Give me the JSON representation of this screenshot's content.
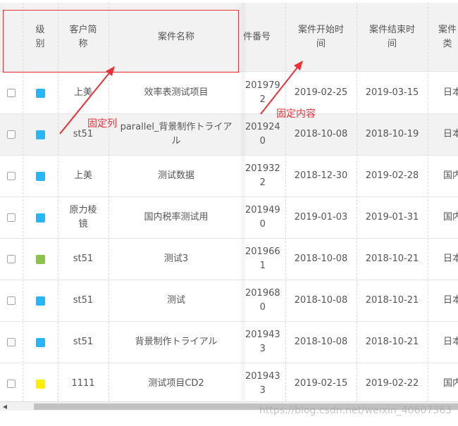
{
  "headers": {
    "level": "级\n别",
    "client": "客户简\n称",
    "case_name": "案件名称",
    "case_no": "件番号",
    "start": "案件开始时\n间",
    "end": "案件结束时\n间",
    "type": "案件\n类"
  },
  "rows": [
    {
      "color": "#29b6f6",
      "client": "上美",
      "name": "效率表测试项目",
      "no": "201979\n2",
      "start": "2019-02-25",
      "end": "2019-03-15",
      "type": "日本"
    },
    {
      "color": "#29b6f6",
      "client": "st51",
      "name": "parallel_背景制作トライア\nル",
      "no": "201924\n0",
      "start": "2018-10-08",
      "end": "2018-10-19",
      "type": "日本"
    },
    {
      "color": "#29b6f6",
      "client": "上美",
      "name": "测试数据",
      "no": "201932\n2",
      "start": "2018-12-30",
      "end": "2019-02-28",
      "type": "国内"
    },
    {
      "color": "#29b6f6",
      "client": "原力棱\n镜",
      "name": "国内税率测试用",
      "no": "201949\n0",
      "start": "2019-01-03",
      "end": "2019-01-31",
      "type": "国内"
    },
    {
      "color": "#8bc34a",
      "client": "st51",
      "name": "测试3",
      "no": "201966\n1",
      "start": "2018-10-08",
      "end": "2018-10-21",
      "type": "日本"
    },
    {
      "color": "#29b6f6",
      "client": "st51",
      "name": "测试",
      "no": "201968\n0",
      "start": "2018-10-08",
      "end": "2018-10-21",
      "type": "日本"
    },
    {
      "color": "#29b6f6",
      "client": "st51",
      "name": "背景制作トライアル",
      "no": "201943\n3",
      "start": "2018-10-08",
      "end": "2018-10-21",
      "type": "日本"
    },
    {
      "color": "#ffee00",
      "client": "1111",
      "name": "测试项目CD2",
      "no": "201943\n3",
      "start": "2019-02-15",
      "end": "2019-02-22",
      "type": "国内"
    }
  ],
  "annotations": {
    "fixed_columns": "固定列",
    "fixed_content": "固定内容",
    "color": "#e8333a"
  },
  "scrollbar": {
    "left_arrow": "◀"
  },
  "watermark": "https://blog.csdn.net/weixin_40607363"
}
